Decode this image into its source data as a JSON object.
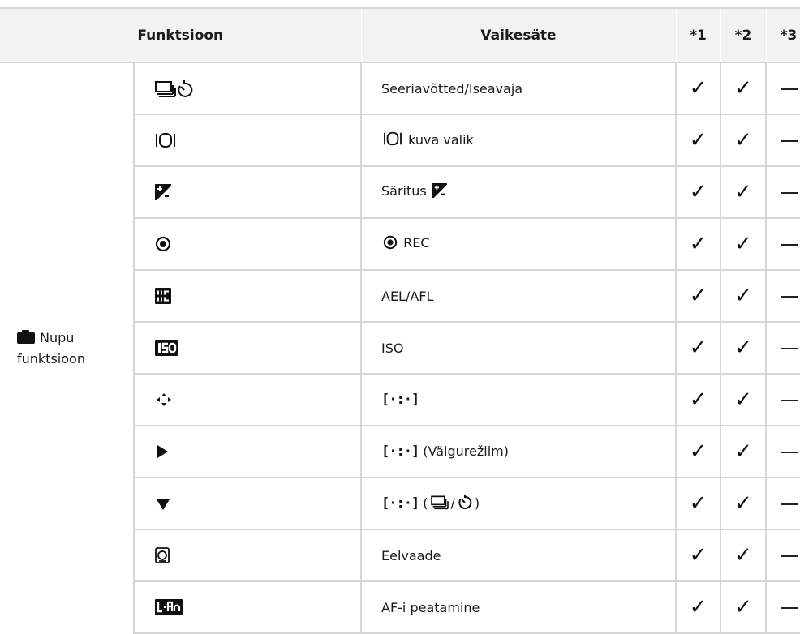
{
  "header": {
    "function": "Funktsioon",
    "default": "Vaikesäte",
    "col1": "*1",
    "col2": "*2",
    "col3": "*3"
  },
  "group": {
    "line1": "Nupu",
    "line2": "funktsioon",
    "icon": "camera-icon"
  },
  "rows": [
    {
      "icon": "sequential-selftimer-icon",
      "setting": "Seeriavõtted/Iseavaja"
    },
    {
      "icon": "multi-view-icon",
      "setting": "kuva valik"
    },
    {
      "icon": "exposure-compensation-icon",
      "setting": "Säritus"
    },
    {
      "icon": "record-icon",
      "setting": "REC"
    },
    {
      "icon": "ael-afl-icon",
      "setting": "AEL/AFL"
    },
    {
      "icon": "iso-icon",
      "setting": "ISO"
    },
    {
      "icon": "arrow-pad-icon",
      "setting": ""
    },
    {
      "icon": "play-icon",
      "setting": "(Välgurežiim)"
    },
    {
      "icon": "down-triangle-icon",
      "setting": "(",
      "suffix_sep": "/",
      "suffix_end": ")"
    },
    {
      "icon": "preview-icon",
      "setting": "Eelvaade"
    },
    {
      "icon": "l-fn-icon",
      "setting": "AF-i peatamine"
    }
  ],
  "marks": {
    "col1": "✓",
    "col2": "✓",
    "col3": "—"
  }
}
